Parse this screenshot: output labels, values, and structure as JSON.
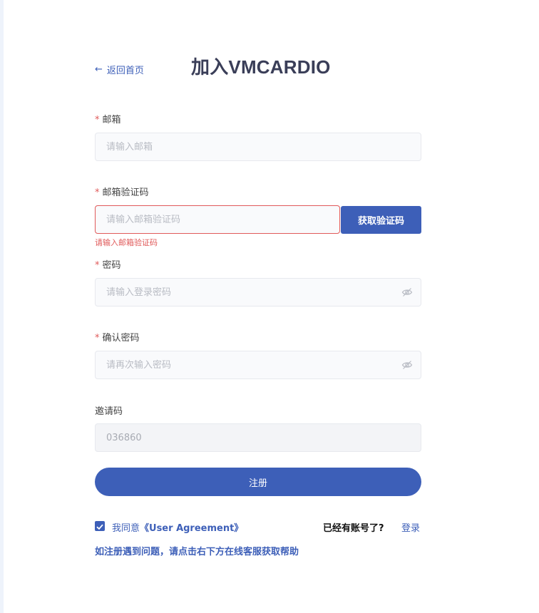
{
  "header": {
    "back_label": "返回首页",
    "title": "加入VMCARDIO"
  },
  "form": {
    "email": {
      "label": "邮箱",
      "placeholder": "请输入邮箱",
      "required": "*"
    },
    "email_code": {
      "label": "邮箱验证码",
      "placeholder": "请输入邮箱验证码",
      "required": "*",
      "button": "获取验证码",
      "error": "请输入邮箱验证码"
    },
    "password": {
      "label": "密码",
      "placeholder": "请输入登录密码",
      "required": "*"
    },
    "confirm_password": {
      "label": "确认密码",
      "placeholder": "请再次输入密码",
      "required": "*"
    },
    "invite_code": {
      "label": "邀请码",
      "value": "036860"
    },
    "submit": "注册"
  },
  "footer": {
    "agree_prefix": "我同意",
    "agree_link": "《User Agreement》",
    "have_account": "已经有账号了?",
    "login": "登录",
    "help": "如注册遇到问题，请点击右下方在线客服获取帮助"
  },
  "colors": {
    "primary": "#3d5fb8",
    "error": "#e05a5a",
    "title": "#3a3e58"
  }
}
